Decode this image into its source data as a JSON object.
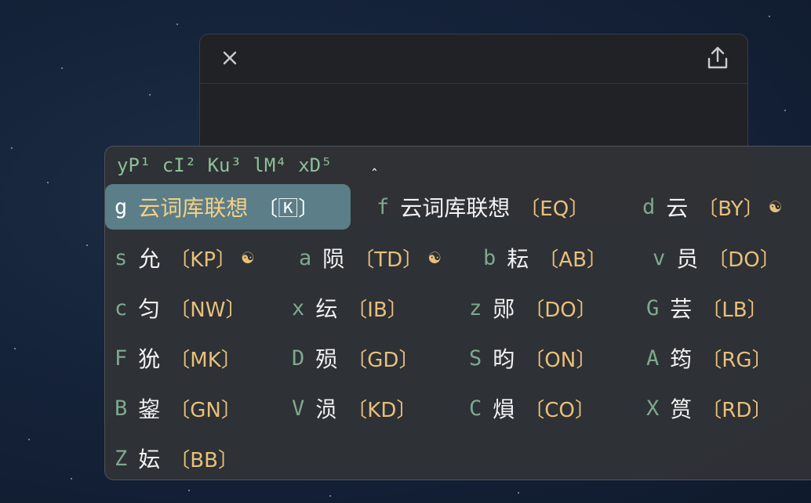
{
  "note_window": {
    "close_icon": "close-icon",
    "share_icon": "share-icon"
  },
  "ime": {
    "preedit": "yP¹ cI² Ku³ lM⁴ xD⁵",
    "caret": "ˆ",
    "candidates": [
      {
        "key": "g",
        "text": "云词库联想",
        "comment": "〔🄺〕",
        "badge": "",
        "selected": true
      },
      {
        "key": "f",
        "text": "云词库联想",
        "comment": "〔EQ〕",
        "badge": ""
      },
      {
        "key": "d",
        "text": "云",
        "comment": "〔BY〕",
        "badge": "☯"
      },
      {
        "key": "s",
        "text": "允",
        "comment": "〔KP〕",
        "badge": "☯"
      },
      {
        "key": "a",
        "text": "陨",
        "comment": "〔TD〕",
        "badge": "☯"
      },
      {
        "key": "b",
        "text": "耘",
        "comment": "〔AB〕",
        "badge": ""
      },
      {
        "key": "v",
        "text": "员",
        "comment": "〔DO〕",
        "badge": ""
      },
      {
        "key": "c",
        "text": "匀",
        "comment": "〔NW〕",
        "badge": ""
      },
      {
        "key": "x",
        "text": "纭",
        "comment": "〔IB〕",
        "badge": ""
      },
      {
        "key": "z",
        "text": "郧",
        "comment": "〔DO〕",
        "badge": ""
      },
      {
        "key": "G",
        "text": "芸",
        "comment": "〔LB〕",
        "badge": ""
      },
      {
        "key": "F",
        "text": "狁",
        "comment": "〔MK〕",
        "badge": ""
      },
      {
        "key": "D",
        "text": "殒",
        "comment": "〔GD〕",
        "badge": ""
      },
      {
        "key": "S",
        "text": "昀",
        "comment": "〔ON〕",
        "badge": ""
      },
      {
        "key": "A",
        "text": "筠",
        "comment": "〔RG〕",
        "badge": ""
      },
      {
        "key": "B",
        "text": "鋆",
        "comment": "〔GN〕",
        "badge": ""
      },
      {
        "key": "V",
        "text": "涢",
        "comment": "〔KD〕",
        "badge": ""
      },
      {
        "key": "C",
        "text": "熉",
        "comment": "〔CO〕",
        "badge": ""
      },
      {
        "key": "X",
        "text": "筼",
        "comment": "〔RD〕",
        "badge": ""
      },
      {
        "key": "Z",
        "text": "妘",
        "comment": "〔BB〕",
        "badge": ""
      }
    ]
  }
}
